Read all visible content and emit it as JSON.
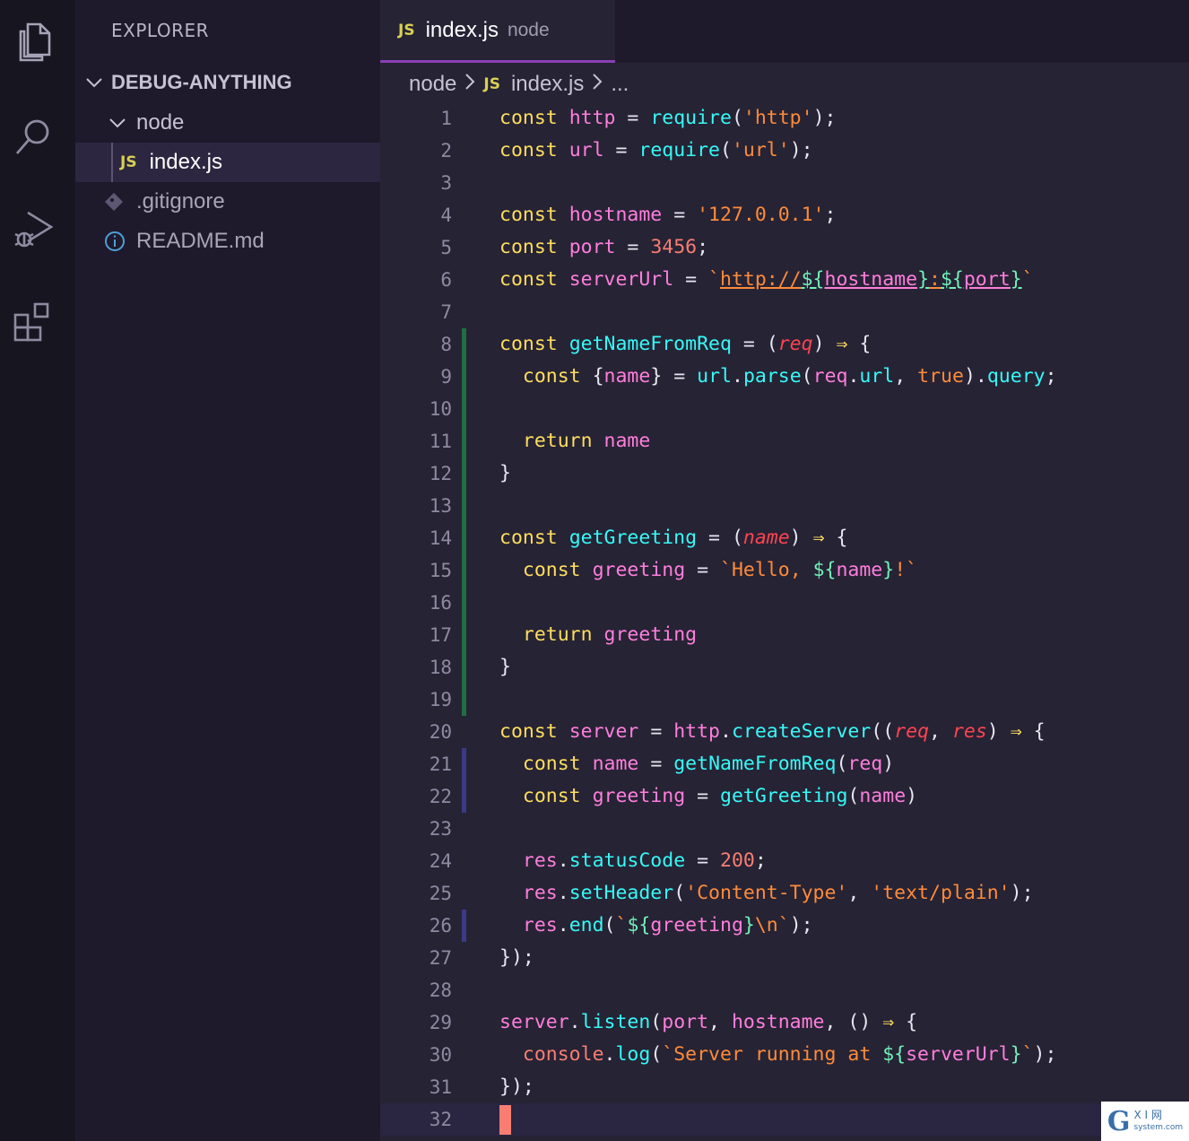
{
  "activity_bar": {
    "items": [
      "explorer-icon",
      "search-icon",
      "run-debug-icon",
      "extensions-icon"
    ]
  },
  "sidebar": {
    "title": "EXPLORER",
    "root": "DEBUG-ANYTHING",
    "folder": "node",
    "files": [
      {
        "name": "index.js",
        "icon": "js",
        "badge": "JS",
        "selected": true
      },
      {
        "name": ".gitignore",
        "icon": "git"
      },
      {
        "name": "README.md",
        "icon": "info"
      }
    ]
  },
  "editor": {
    "tab": {
      "badge": "JS",
      "name": "index.js",
      "description": "node"
    },
    "breadcrumb": {
      "folder": "node",
      "badge": "JS",
      "file": "index.js",
      "more": "..."
    },
    "line_numbers": [
      "1",
      "2",
      "3",
      "4",
      "5",
      "6",
      "7",
      "8",
      "9",
      "10",
      "11",
      "12",
      "13",
      "14",
      "15",
      "16",
      "17",
      "18",
      "19",
      "20",
      "21",
      "22",
      "23",
      "24",
      "25",
      "26",
      "27",
      "28",
      "29",
      "30",
      "31",
      "32"
    ],
    "lines": [
      "const http = require('http');",
      "const url = require('url');",
      "",
      "const hostname = '127.0.0.1';",
      "const port = 3456;",
      "const serverUrl = `http://${hostname}:${port}`",
      "",
      "const getNameFromReq = (req) ⇒ {",
      "  const {name} = url.parse(req.url, true).query;",
      "",
      "  return name",
      "}",
      "",
      "const getGreeting = (name) ⇒ {",
      "  const greeting = `Hello, ${name}!`",
      "",
      "  return greeting",
      "}",
      "",
      "const server = http.createServer((req, res) ⇒ {",
      "  const name = getNameFromReq(req)",
      "  const greeting = getGreeting(name)",
      "",
      "  res.statusCode = 200;",
      "  res.setHeader('Content-Type', 'text/plain');",
      "  res.end(`${greeting}\\n`);",
      "});",
      "",
      "server.listen(port, hostname, () ⇒ {",
      "  console.log(`Server running at ${serverUrl}`);",
      "});",
      ""
    ],
    "added_lines": [
      8,
      19
    ],
    "modified_lines": [
      [
        21,
        22
      ],
      [
        26,
        26
      ]
    ],
    "cursor_line": 32,
    "colors": {
      "keyword": "#fede5d",
      "variable": "#ff7edb",
      "function": "#36f9f6",
      "string": "#ff8b39",
      "number": "#f97e72",
      "template": "#72f1b8",
      "added_gutter": "#1f6f43",
      "modified_gutter": "#3b3a88"
    }
  },
  "watermark": {
    "logo": "G",
    "text_top": "X I 网",
    "text_bottom": "system.com"
  }
}
